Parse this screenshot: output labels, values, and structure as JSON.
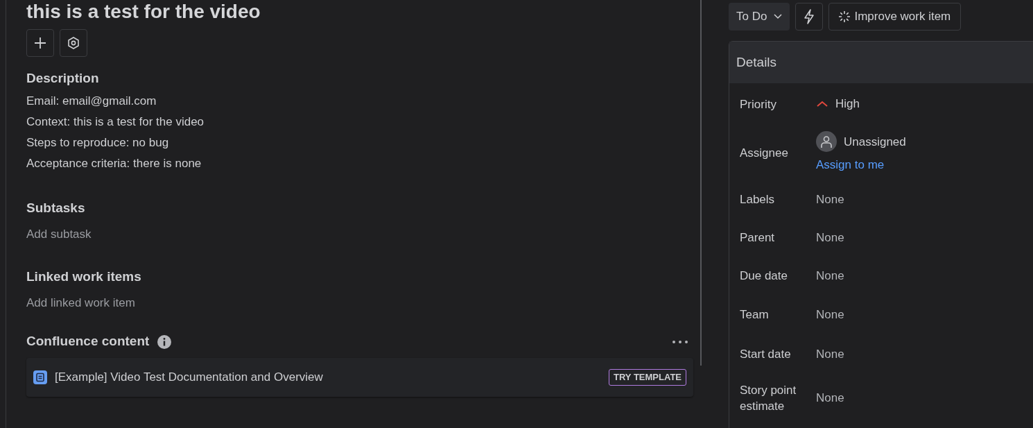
{
  "title": "this is a test for the video",
  "description": {
    "heading": "Description",
    "lines": [
      "Email: email@gmail.com",
      "Context: this is a test for the video",
      "Steps to reproduce: no bug",
      "Acceptance criteria: there is none"
    ]
  },
  "subtasks": {
    "heading": "Subtasks",
    "add_label": "Add subtask"
  },
  "linked_work_items": {
    "heading": "Linked work items",
    "add_label": "Add linked work item"
  },
  "confluence": {
    "heading": "Confluence content",
    "items": [
      {
        "title": "[Example] Video Test Documentation and Overview",
        "badge": "TRY TEMPLATE"
      }
    ]
  },
  "status_button": {
    "label": "To Do"
  },
  "improve_button": {
    "label": "Improve work item"
  },
  "details": {
    "heading": "Details",
    "fields": [
      {
        "kind": "priority",
        "label": "Priority",
        "value": "High"
      },
      {
        "kind": "assignee",
        "label": "Assignee",
        "value": "Unassigned",
        "link": "Assign to me"
      },
      {
        "kind": "plain",
        "label": "Labels",
        "value": "None"
      },
      {
        "kind": "plain",
        "label": "Parent",
        "value": "None"
      },
      {
        "kind": "plain",
        "label": "Due date",
        "value": "None"
      },
      {
        "kind": "plain",
        "label": "Team",
        "value": "None"
      },
      {
        "kind": "plain",
        "label": "Start date",
        "value": "None"
      },
      {
        "kind": "plain",
        "label": "Story point estimate",
        "value": "None"
      }
    ]
  }
}
